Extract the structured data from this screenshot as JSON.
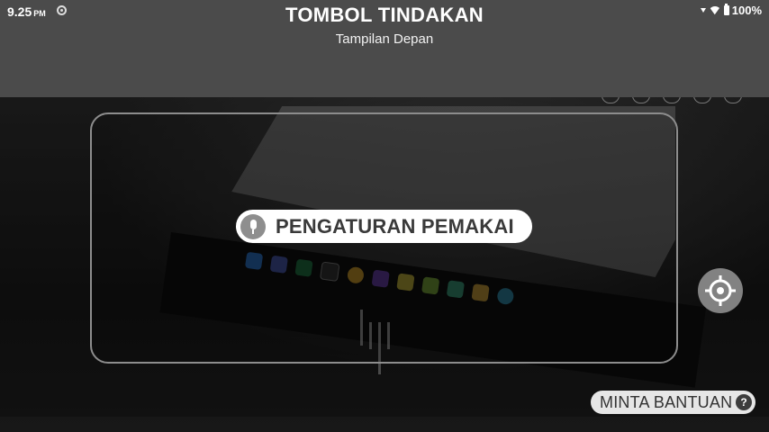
{
  "status_bar": {
    "time": "9.25",
    "ampm": "PM",
    "battery": "100%"
  },
  "header": {
    "title": "TOMBOL TINDAKAN",
    "subtitle": "Tampilan Depan"
  },
  "action_chip": {
    "label": "PENGATURAN PEMAKAI",
    "icon": "microphone-icon"
  },
  "target_button": {
    "icon": "crosshair-icon"
  },
  "help_button": {
    "label": "MINTA BANTUAN",
    "badge": "?"
  },
  "colors": {
    "header_bg": "#4b4b4b",
    "chip_bg": "#ffffff",
    "chip_text": "#3a3a3a"
  }
}
